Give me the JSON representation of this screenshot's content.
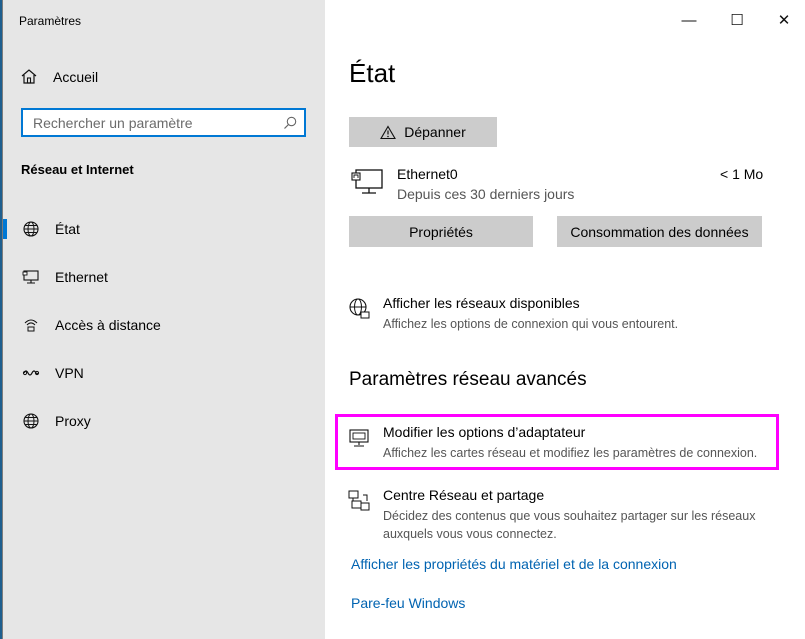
{
  "window": {
    "title": "Paramètres",
    "controls": {
      "minimize": "—",
      "maximize": "☐",
      "close": "✕"
    }
  },
  "sidebar": {
    "home_label": "Accueil",
    "search_placeholder": "Rechercher un paramètre",
    "section_title": "Réseau et Internet",
    "items": [
      {
        "label": "État",
        "icon": "globe-icon",
        "active": true
      },
      {
        "label": "Ethernet",
        "icon": "ethernet-icon",
        "active": false
      },
      {
        "label": "Accès à distance",
        "icon": "dialup-icon",
        "active": false
      },
      {
        "label": "VPN",
        "icon": "vpn-icon",
        "active": false
      },
      {
        "label": "Proxy",
        "icon": "globe-icon",
        "active": false
      }
    ]
  },
  "main": {
    "title": "État",
    "troubleshoot_label": "Dépanner",
    "ethernet": {
      "name": "Ethernet0",
      "sub": "Depuis ces 30 derniers jours",
      "usage": "< 1 Mo"
    },
    "properties_label": "Propriétés",
    "data_usage_label": "Consommation des données",
    "show_networks": {
      "title": "Afficher les réseaux disponibles",
      "desc": "Affichez les options de connexion qui vous entourent."
    },
    "advanced_heading": "Paramètres réseau avancés",
    "adapter_options": {
      "title": "Modifier les options d’adaptateur",
      "desc": "Affichez les cartes réseau et modifiez les paramètres de connexion."
    },
    "sharing_center": {
      "title": "Centre Réseau et partage",
      "desc": "Décidez des contenus que vous souhaitez partager sur les réseaux auxquels vous vous connectez."
    },
    "links": {
      "hardware_props": "Afficher les propriétés du matériel et de la connexion",
      "firewall": "Pare-feu Windows"
    }
  },
  "colors": {
    "accent": "#0078d4",
    "link": "#0063b1",
    "highlight": "#ff00ff",
    "sidebar_bg": "#e6e6e6",
    "button_bg": "#cccccc"
  }
}
